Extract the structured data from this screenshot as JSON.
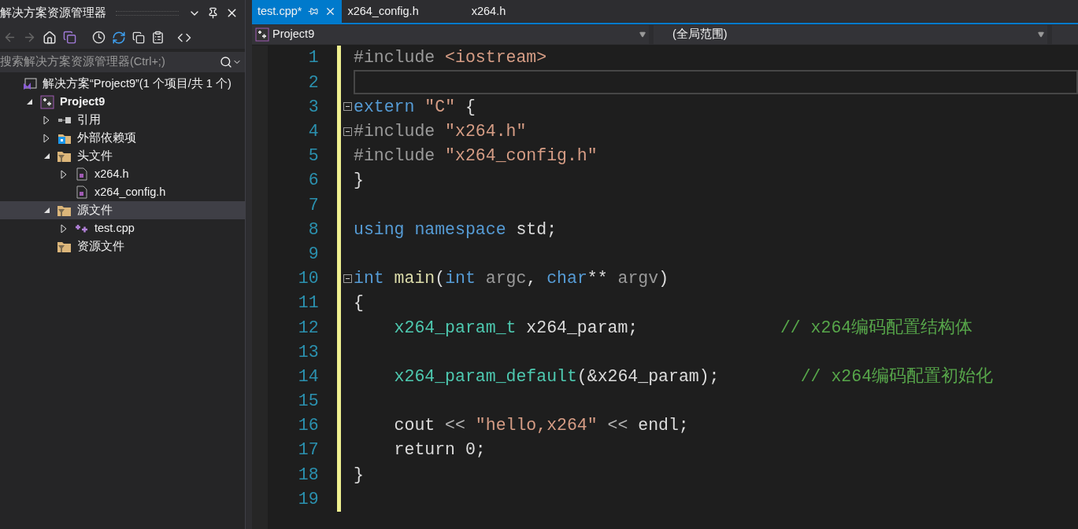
{
  "sidebar": {
    "title": "解决方案资源管理器",
    "search": {
      "placeholder": "搜索解决方案资源管理器(Ctrl+;)"
    },
    "tree": [
      {
        "label": "解决方案“Project9”(1 个项目/共 1 个)",
        "kind": "solution",
        "expandable": false,
        "selected": false,
        "children": [
          {
            "label": "Project9",
            "kind": "project",
            "expandable": true,
            "expanded": true,
            "selected": false,
            "children": [
              {
                "label": "引用",
                "kind": "references",
                "expandable": true,
                "expanded": false,
                "selected": false
              },
              {
                "label": "外部依赖项",
                "kind": "external",
                "expandable": true,
                "expanded": false,
                "selected": false
              },
              {
                "label": "头文件",
                "kind": "filter",
                "expandable": true,
                "expanded": true,
                "selected": false,
                "children": [
                  {
                    "label": "x264.h",
                    "kind": "header",
                    "expandable": true,
                    "expanded": false,
                    "selected": false
                  },
                  {
                    "label": "x264_config.h",
                    "kind": "header",
                    "expandable": false,
                    "selected": false
                  }
                ]
              },
              {
                "label": "源文件",
                "kind": "filter",
                "expandable": true,
                "expanded": true,
                "selected": true,
                "children": [
                  {
                    "label": "test.cpp",
                    "kind": "cpp",
                    "expandable": true,
                    "expanded": false,
                    "selected": false
                  }
                ]
              },
              {
                "label": "资源文件",
                "kind": "filter",
                "expandable": false,
                "selected": false
              }
            ]
          }
        ]
      }
    ]
  },
  "tabs": [
    {
      "label": "test.cpp*",
      "selected": true
    },
    {
      "label": "x264_config.h",
      "selected": false
    },
    {
      "label": "x264.h",
      "selected": false
    }
  ],
  "navigation": {
    "project": "Project9",
    "scope": "(全局范围)"
  },
  "code_lines": [
    {
      "number": "1",
      "current": false,
      "fold": false,
      "tokens": [
        {
          "text": "#include",
          "kind": "directive"
        },
        {
          "text": " <iostream>",
          "kind": "string"
        }
      ]
    },
    {
      "number": "2",
      "current": true,
      "fold": false
    },
    {
      "number": "3",
      "current": false,
      "fold": true,
      "tokens": [
        {
          "text": "extern",
          "kind": "keyword"
        },
        {
          "text": " \"C\"",
          "kind": "string"
        },
        {
          "text": " {",
          "kind": "plain"
        }
      ]
    },
    {
      "number": "4",
      "current": false,
      "fold": true,
      "tokens": [
        {
          "text": "#include",
          "kind": "directive"
        },
        {
          "text": " \"x264.h\"",
          "kind": "string"
        }
      ]
    },
    {
      "number": "5",
      "current": false,
      "fold": false,
      "tokens": [
        {
          "text": "#include",
          "kind": "directive"
        },
        {
          "text": " \"x264_config.h\"",
          "kind": "string"
        }
      ]
    },
    {
      "number": "6",
      "current": false,
      "fold": false,
      "tokens": [
        {
          "text": "}",
          "kind": "plain"
        }
      ]
    },
    {
      "number": "7",
      "current": false,
      "fold": false
    },
    {
      "number": "8",
      "current": false,
      "fold": false,
      "tokens": [
        {
          "text": "using namespace",
          "kind": "keyword"
        },
        {
          "text": " std;",
          "kind": "plain"
        }
      ]
    },
    {
      "number": "9",
      "current": false,
      "fold": false
    },
    {
      "number": "10",
      "current": false,
      "fold": true,
      "tokens": [
        {
          "text": "int",
          "kind": "keyword"
        },
        {
          "text": " main",
          "kind": "function"
        },
        {
          "text": "(",
          "kind": "plain"
        },
        {
          "text": "int",
          "kind": "keyword"
        },
        {
          "text": " argc",
          "kind": "parameter"
        },
        {
          "text": ", ",
          "kind": "plain"
        },
        {
          "text": "char",
          "kind": "keyword"
        },
        {
          "text": "** ",
          "kind": "plain"
        },
        {
          "text": "argv",
          "kind": "parameter"
        },
        {
          "text": ")",
          "kind": "plain"
        }
      ]
    },
    {
      "number": "11",
      "current": false,
      "fold": false,
      "tokens": [
        {
          "text": "{",
          "kind": "plain"
        }
      ]
    },
    {
      "number": "12",
      "current": false,
      "fold": false,
      "tokens": [
        {
          "text": "    x264_param_t",
          "kind": "type"
        },
        {
          "text": " x264_param;              ",
          "kind": "plain"
        },
        {
          "text": "// x264编码配置结构体",
          "kind": "comment"
        }
      ]
    },
    {
      "number": "13",
      "current": false,
      "fold": false
    },
    {
      "number": "14",
      "current": false,
      "fold": false,
      "tokens": [
        {
          "text": "    x264_param_default",
          "kind": "type"
        },
        {
          "text": "(&x264_param);        ",
          "kind": "plain"
        },
        {
          "text": "// x264编码配置初始化",
          "kind": "comment"
        }
      ]
    },
    {
      "number": "15",
      "current": false,
      "fold": false
    },
    {
      "number": "16",
      "current": false,
      "fold": false,
      "tokens": [
        {
          "text": "    cout",
          "kind": "plain"
        },
        {
          "text": " << ",
          "kind": "operator"
        },
        {
          "text": "\"hello,x264\"",
          "kind": "string"
        },
        {
          "text": " << ",
          "kind": "operator"
        },
        {
          "text": "endl;",
          "kind": "plain"
        }
      ]
    },
    {
      "number": "17",
      "current": false,
      "fold": false,
      "tokens": [
        {
          "text": "    return 0;",
          "kind": "plain"
        }
      ]
    },
    {
      "number": "18",
      "current": false,
      "fold": false,
      "tokens": [
        {
          "text": "}",
          "kind": "plain"
        }
      ]
    },
    {
      "number": "19",
      "current": false,
      "fold": false
    }
  ]
}
